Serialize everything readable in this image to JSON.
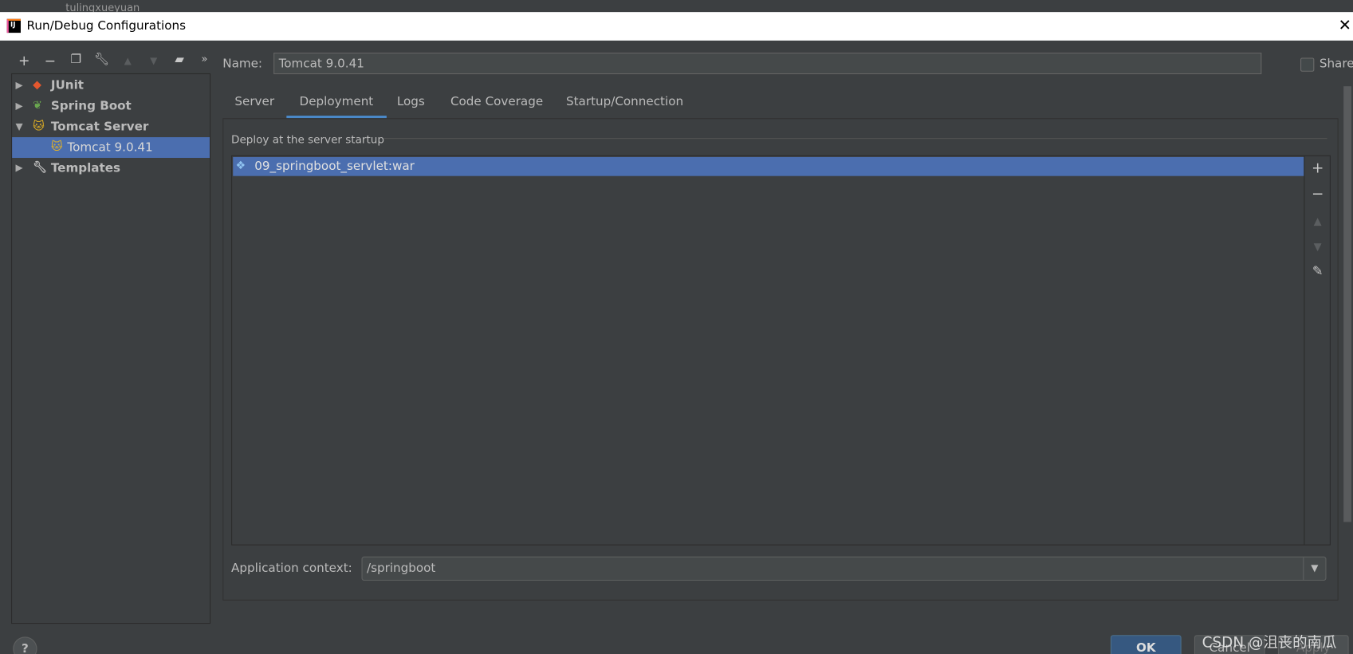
{
  "background_ide": {
    "project_folder": "tulingxueyuan"
  },
  "window": {
    "title": "Run/Debug Configurations",
    "app_icon": "intellij-icon",
    "close": "✕"
  },
  "toolbar": {
    "items": [
      "add-icon",
      "remove-icon",
      "copy-icon",
      "wrench-icon",
      "move-up-icon",
      "move-down-icon",
      "new-folder-icon",
      "more-icon"
    ]
  },
  "tree": {
    "items": [
      {
        "label": "JUnit",
        "expanded": false
      },
      {
        "label": "Spring Boot",
        "expanded": false
      },
      {
        "label": "Tomcat Server",
        "expanded": true
      },
      {
        "label": "Tomcat 9.0.41",
        "selected": true
      },
      {
        "label": "Templates",
        "expanded": false
      }
    ]
  },
  "name_field": {
    "label": "Name:",
    "value": "Tomcat 9.0.41"
  },
  "share": {
    "label": "Share",
    "checked": false
  },
  "tabs": [
    {
      "label": "Server"
    },
    {
      "label": "Deployment",
      "active": true
    },
    {
      "label": "Logs"
    },
    {
      "label": "Code Coverage"
    },
    {
      "label": "Startup/Connection"
    }
  ],
  "deployment": {
    "section_title": "Deploy at the server startup",
    "artifacts": [
      "09_springboot_servlet:war"
    ],
    "context_label": "Application context:",
    "context_value": "/springboot"
  },
  "buttons": {
    "help": "?",
    "ok": "OK",
    "cancel": "Cancel",
    "apply": "Apply"
  },
  "watermark": "CSDN @沮丧的南瓜",
  "colors": {
    "accent": "#4a88c7",
    "selection": "#4b6eaf",
    "ok_button": "#365880",
    "background": "#3c3f41"
  }
}
